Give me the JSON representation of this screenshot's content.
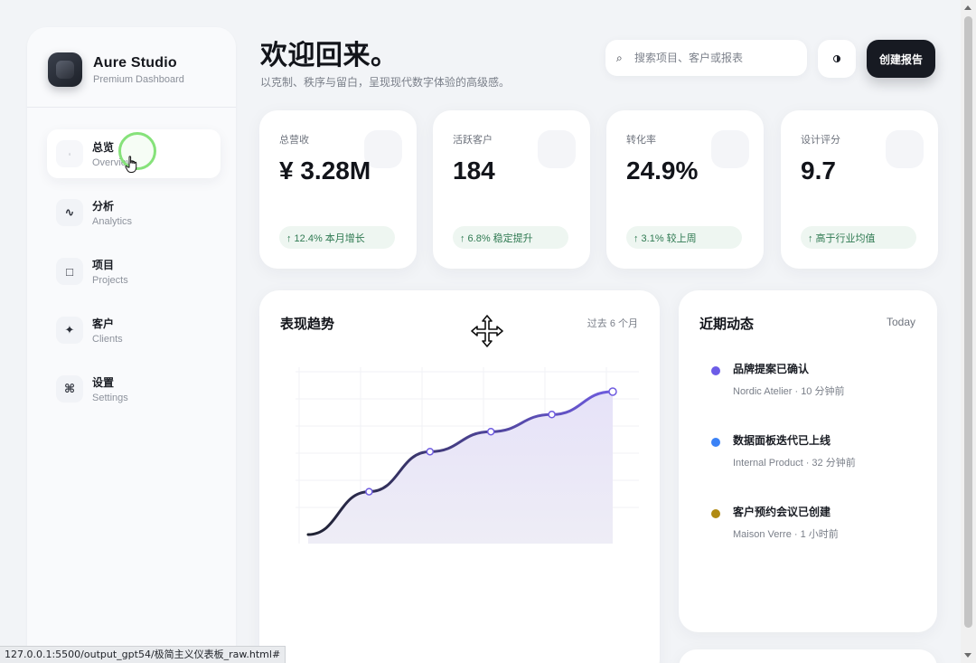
{
  "brand": {
    "name": "Aure Studio",
    "subtitle": "Premium Dashboard"
  },
  "nav": [
    {
      "label": "总览",
      "sub": "Overview",
      "icon": "dot-icon",
      "glyph": "◦",
      "active": true
    },
    {
      "label": "分析",
      "sub": "Analytics",
      "icon": "wave-icon",
      "glyph": "∿",
      "active": false
    },
    {
      "label": "项目",
      "sub": "Projects",
      "icon": "square-icon",
      "glyph": "□",
      "active": false
    },
    {
      "label": "客户",
      "sub": "Clients",
      "icon": "sparkle-icon",
      "glyph": "✦",
      "active": false
    },
    {
      "label": "设置",
      "sub": "Settings",
      "icon": "command-icon",
      "glyph": "⌘",
      "active": false
    }
  ],
  "header": {
    "title": "欢迎回来。",
    "subtitle": "以克制、秩序与留白，呈现现代数字体验的高级感。",
    "search_placeholder": "搜索项目、客户或报表",
    "search_glyph": "⌕",
    "report_button": "创建报告"
  },
  "stats": [
    {
      "label": "总营收",
      "value": "¥ 3.28M",
      "badge": "↑ 12.4% 本月增长"
    },
    {
      "label": "活跃客户",
      "value": "184",
      "badge": "↑ 6.8% 稳定提升"
    },
    {
      "label": "转化率",
      "value": "24.9%",
      "badge": "↑ 3.1% 较上周"
    },
    {
      "label": "设计评分",
      "value": "9.7",
      "badge": "↑ 高于行业均值"
    }
  ],
  "trend": {
    "title": "表现趋势",
    "range": "过去 6 个月"
  },
  "chart_data": {
    "type": "area",
    "title": "表现趋势",
    "xlabel": "",
    "ylabel": "",
    "x": [
      0,
      1,
      2,
      3,
      4,
      5
    ],
    "values": [
      0,
      30,
      58,
      72,
      84,
      100
    ],
    "ylim": [
      0,
      100
    ],
    "grid": true,
    "colors": {
      "line_start": "#1e2130",
      "line_end": "#6f5ce0",
      "fill": "#ece9f9",
      "point": "#6f5ce0"
    }
  },
  "activity": {
    "title": "近期动态",
    "today": "Today",
    "items": [
      {
        "name": "品牌提案已确认",
        "meta": "Nordic Atelier · 10 分钟前",
        "color": "#6c5ce7"
      },
      {
        "name": "数据面板迭代已上线",
        "meta": "Internal Product · 32 分钟前",
        "color": "#3b82f6"
      },
      {
        "name": "客户预约会议已创建",
        "meta": "Maison Verre · 1 小时前",
        "color": "#b08a12"
      }
    ]
  },
  "status_bar": {
    "url": "127.0.0.1:5500/output_gpt54/极简主义仪表板_raw.html#"
  }
}
